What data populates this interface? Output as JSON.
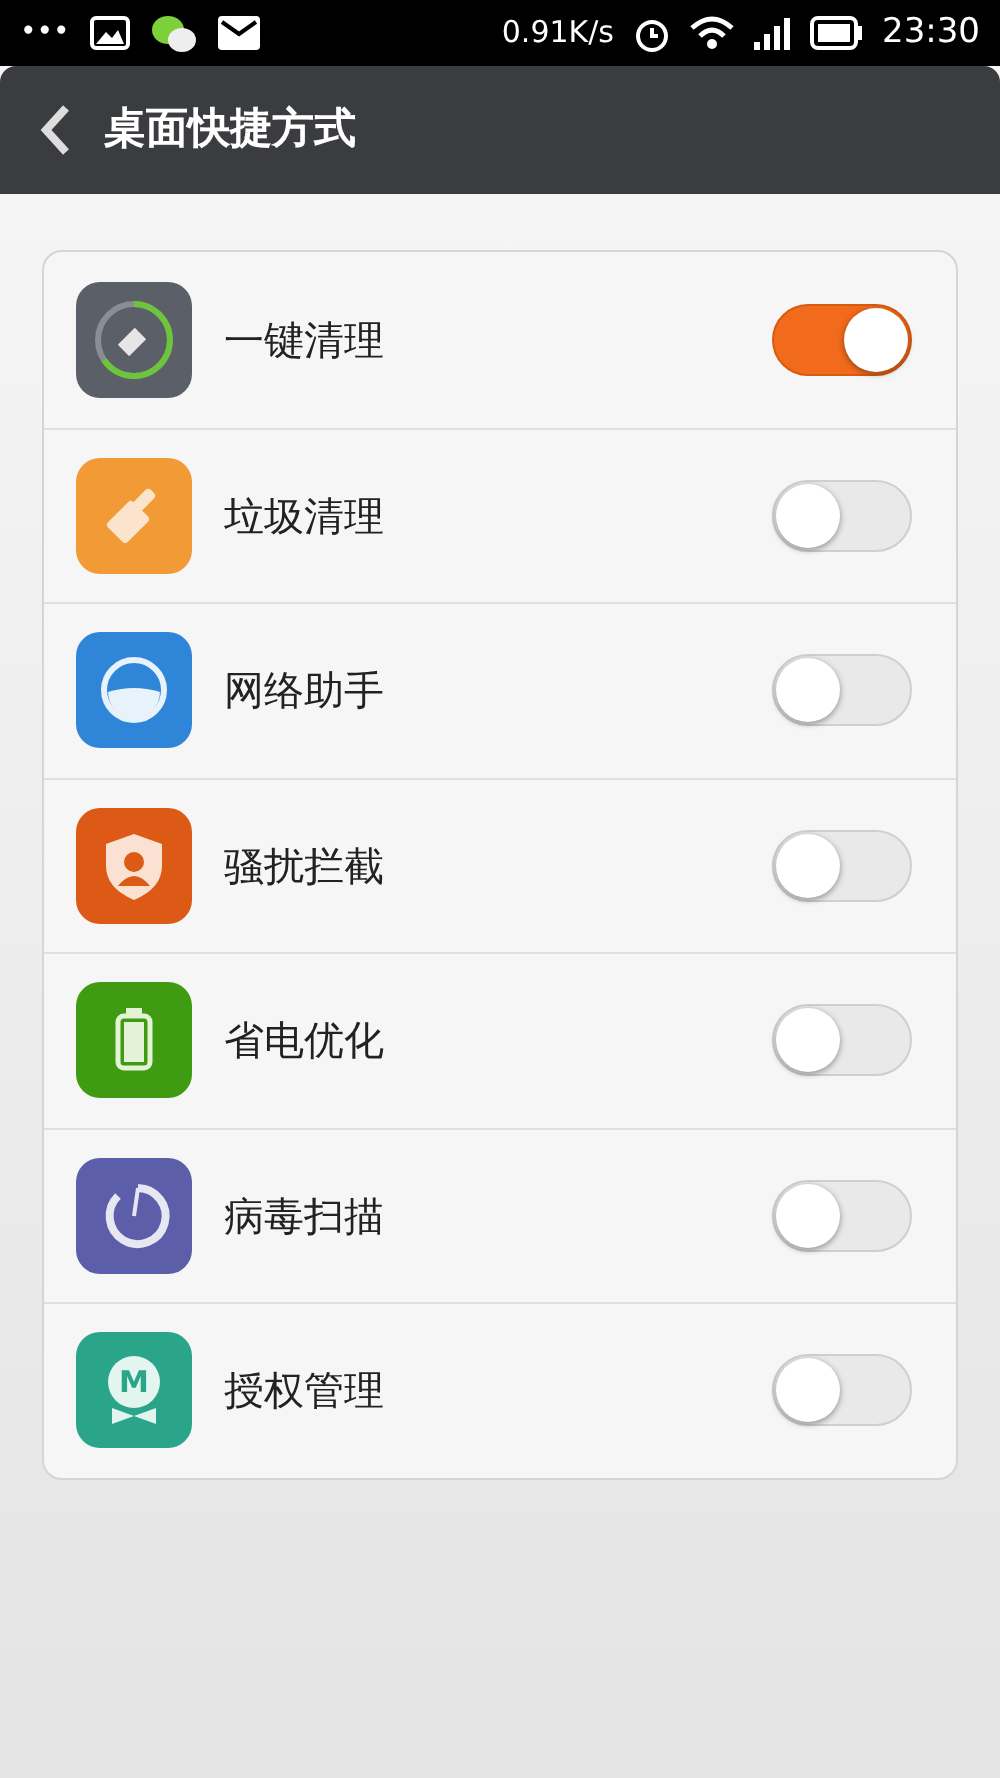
{
  "status_bar": {
    "more": "•••",
    "speed": "0.91K/s",
    "time": "23:30"
  },
  "header": {
    "title": "桌面快捷方式"
  },
  "items": [
    {
      "label": "一键清理",
      "kind": "cleanup",
      "on": true
    },
    {
      "label": "垃圾清理",
      "kind": "broom",
      "on": false
    },
    {
      "label": "网络助手",
      "kind": "network",
      "on": false
    },
    {
      "label": "骚扰拦截",
      "kind": "shield",
      "on": false
    },
    {
      "label": "省电优化",
      "kind": "battery",
      "on": false
    },
    {
      "label": "病毒扫描",
      "kind": "scan",
      "on": false
    },
    {
      "label": "授权管理",
      "kind": "permission",
      "on": false,
      "icon_letter": "M"
    }
  ]
}
